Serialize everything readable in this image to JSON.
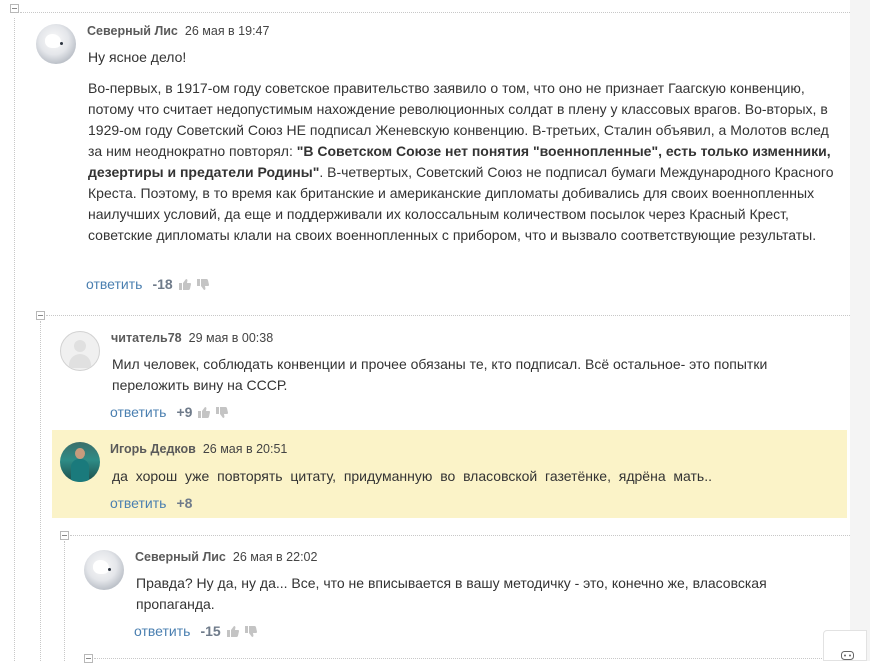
{
  "comments": [
    {
      "author": "Северный Лис",
      "date": "26 мая в 19:47",
      "paragraph_1": "Ну ясное дело!",
      "paragraph_2_pre": "Во-первых, в 1917-ом году советское правительство заявило о том, что оно не признает Гаагскую конвенцию, потому что считает недопустимым нахождение революционных солдат в плену у классовых врагов. Во-вторых, в 1929-ом году Советский Союз НЕ подписал Женевскую конвенцию. В-третьих, Сталин объявил, а Молотов вслед за ним неоднократно повторял: ",
      "paragraph_2_bold": "\"В Советском Союзе нет понятия \"военнопленные\", есть только изменники, дезертиры и предатели Родины\"",
      "paragraph_2_post": ". В-четвертых, Советский Союз не подписал бумаги Международного Красного Креста. Поэтому, в то время как британские и американские дипломаты добивались для своих военнопленных наилучших условий, да еще и поддерживали их колоссальным количеством посылок через Красный Крест, советские дипломаты клали на своих военнопленных с прибором, что и вызвало соответствующие результаты.",
      "reply_label": "ответить",
      "score": "-18"
    },
    {
      "author": "читатель78",
      "date": "29 мая в 00:38",
      "text": "Мил человек, соблюдать конвенции и прочее обязаны те, кто подписал. Всё остальное- это попытки переложить вину на СССР.",
      "reply_label": "ответить",
      "score": "+9"
    },
    {
      "author": "Игорь Дедков",
      "date": "26 мая в 20:51",
      "text": "да хорош уже повторять цитату, придуманную во власовской газетёнке, ядрёна мать..",
      "reply_label": "ответить",
      "score": "+8"
    },
    {
      "author": "Северный Лис",
      "date": "26 мая в 22:02",
      "text": "Правда? Ну да, ну да... Все, что не вписывается в вашу методичку - это, конечно же, власовская пропаганда.",
      "reply_label": "ответить",
      "score": "-15"
    }
  ],
  "colors": {
    "highlight": "#fbf3c8",
    "link": "#4a7fb0",
    "score": "#6f7b8a"
  },
  "icons": [
    "collapse-icon",
    "thumb-up-icon",
    "thumb-down-icon",
    "chat-icon"
  ]
}
